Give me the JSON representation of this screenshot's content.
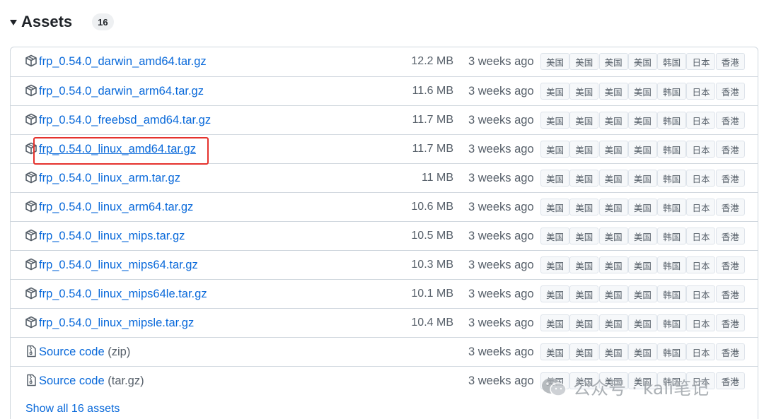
{
  "header": {
    "title": "Assets",
    "count": "16"
  },
  "assets": [
    {
      "name": "frp_0.54.0_darwin_amd64.tar.gz",
      "suffix": "",
      "size": "12.2 MB",
      "time": "3 weeks ago",
      "icon": "package-icon"
    },
    {
      "name": "frp_0.54.0_darwin_arm64.tar.gz",
      "suffix": "",
      "size": "11.6 MB",
      "time": "3 weeks ago",
      "icon": "package-icon"
    },
    {
      "name": "frp_0.54.0_freebsd_amd64.tar.gz",
      "suffix": "",
      "size": "11.7 MB",
      "time": "3 weeks ago",
      "icon": "package-icon"
    },
    {
      "name": "frp_0.54.0_linux_amd64.tar.gz",
      "suffix": "",
      "size": "11.7 MB",
      "time": "3 weeks ago",
      "icon": "package-icon"
    },
    {
      "name": "frp_0.54.0_linux_arm.tar.gz",
      "suffix": "",
      "size": "11 MB",
      "time": "3 weeks ago",
      "icon": "package-icon"
    },
    {
      "name": "frp_0.54.0_linux_arm64.tar.gz",
      "suffix": "",
      "size": "10.6 MB",
      "time": "3 weeks ago",
      "icon": "package-icon"
    },
    {
      "name": "frp_0.54.0_linux_mips.tar.gz",
      "suffix": "",
      "size": "10.5 MB",
      "time": "3 weeks ago",
      "icon": "package-icon"
    },
    {
      "name": "frp_0.54.0_linux_mips64.tar.gz",
      "suffix": "",
      "size": "10.3 MB",
      "time": "3 weeks ago",
      "icon": "package-icon"
    },
    {
      "name": "frp_0.54.0_linux_mips64le.tar.gz",
      "suffix": "",
      "size": "10.1 MB",
      "time": "3 weeks ago",
      "icon": "package-icon"
    },
    {
      "name": "frp_0.54.0_linux_mipsle.tar.gz",
      "suffix": "",
      "size": "10.4 MB",
      "time": "3 weeks ago",
      "icon": "package-icon"
    },
    {
      "name": "Source code",
      "suffix": "(zip)",
      "size": "",
      "time": "3 weeks ago",
      "icon": "file-zip-icon"
    },
    {
      "name": "Source code",
      "suffix": "(tar.gz)",
      "size": "",
      "time": "3 weeks ago",
      "icon": "file-zip-icon"
    }
  ],
  "mirrors": [
    "美国",
    "美国",
    "美国",
    "美国",
    "韩国",
    "日本",
    "香港"
  ],
  "show_all": "Show all 16 assets",
  "watermark": "公众号 · kali笔记",
  "colors": {
    "link": "#0969da",
    "muted": "#57606a",
    "border": "#d0d7de",
    "highlight": "#e5322d"
  }
}
